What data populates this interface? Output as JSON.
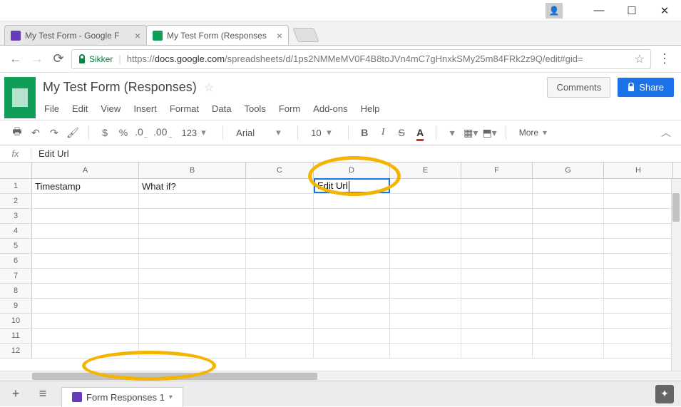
{
  "window": {
    "user_glyph": "👤"
  },
  "browser": {
    "tabs": [
      {
        "title": "My Test Form - Google F",
        "favicon": "purple"
      },
      {
        "title": "My Test Form (Responses",
        "favicon": "green"
      }
    ],
    "secure_label": "Sikker",
    "url_prefix": "https://",
    "url_host": "docs.google.com",
    "url_path": "/spreadsheets/d/1ps2NMMeMV0F4B8toJVn4mC7gHnxkSMy25m84FRk2z9Q/edit#gid="
  },
  "doc": {
    "title": "My Test Form (Responses)",
    "comments_label": "Comments",
    "share_label": "Share"
  },
  "menu": {
    "file": "File",
    "edit": "Edit",
    "view": "View",
    "insert": "Insert",
    "format": "Format",
    "data": "Data",
    "tools": "Tools",
    "form": "Form",
    "addons": "Add-ons",
    "help": "Help"
  },
  "toolbar": {
    "currency": "$",
    "percent": "%",
    "dec_dec": ".0",
    "dec_inc": ".00",
    "num_format": "123",
    "font": "Arial",
    "font_size": "10",
    "bold": "B",
    "italic": "I",
    "strike": "S",
    "more": "More"
  },
  "formula_bar": {
    "fx": "fx",
    "value": "Edit Url"
  },
  "sheet": {
    "columns": [
      "A",
      "B",
      "C",
      "D",
      "E",
      "F",
      "G",
      "H"
    ],
    "rows_shown": 12,
    "cells": {
      "A1": "Timestamp",
      "B1": "What if?",
      "D1": "Edit Url"
    },
    "active_cell": "D1"
  },
  "tabs": {
    "sheet1": "Form Responses 1"
  }
}
